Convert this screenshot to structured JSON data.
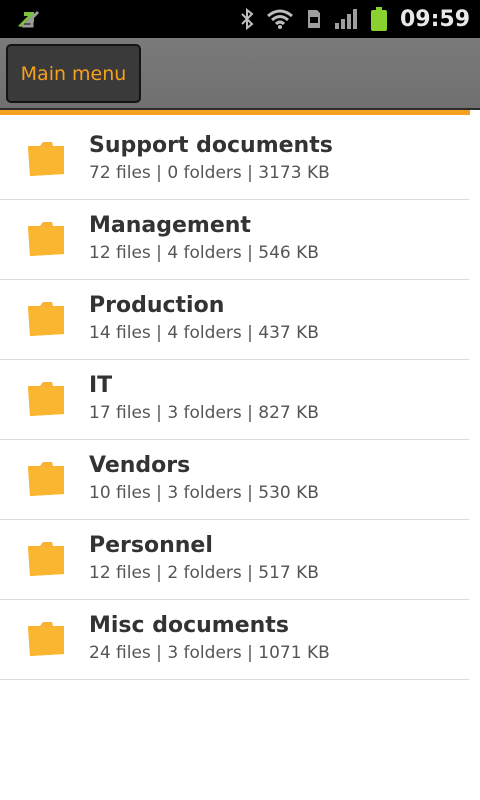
{
  "status_bar": {
    "time": "09:59",
    "icons": [
      "sync-arrows-icon",
      "bluetooth-icon",
      "wifi-icon",
      "sd-card-icon",
      "signal-icon",
      "battery-icon"
    ]
  },
  "header": {
    "menu_label": "Main menu"
  },
  "colors": {
    "accent": "#f6a11e",
    "folder": "#f9b233",
    "battery": "#8ad12f"
  },
  "folders": [
    {
      "name": "Support documents",
      "info": "72 files | 0 folders | 3173 KB"
    },
    {
      "name": "Management",
      "info": "12 files | 4 folders | 546 KB"
    },
    {
      "name": "Production",
      "info": "14 files | 4 folders | 437 KB"
    },
    {
      "name": "IT",
      "info": "17 files | 3 folders | 827 KB"
    },
    {
      "name": "Vendors",
      "info": "10 files | 3 folders | 530 KB"
    },
    {
      "name": "Personnel",
      "info": "12 files | 2 folders | 517 KB"
    },
    {
      "name": "Misc documents",
      "info": "24 files | 3 folders | 1071 KB"
    }
  ]
}
